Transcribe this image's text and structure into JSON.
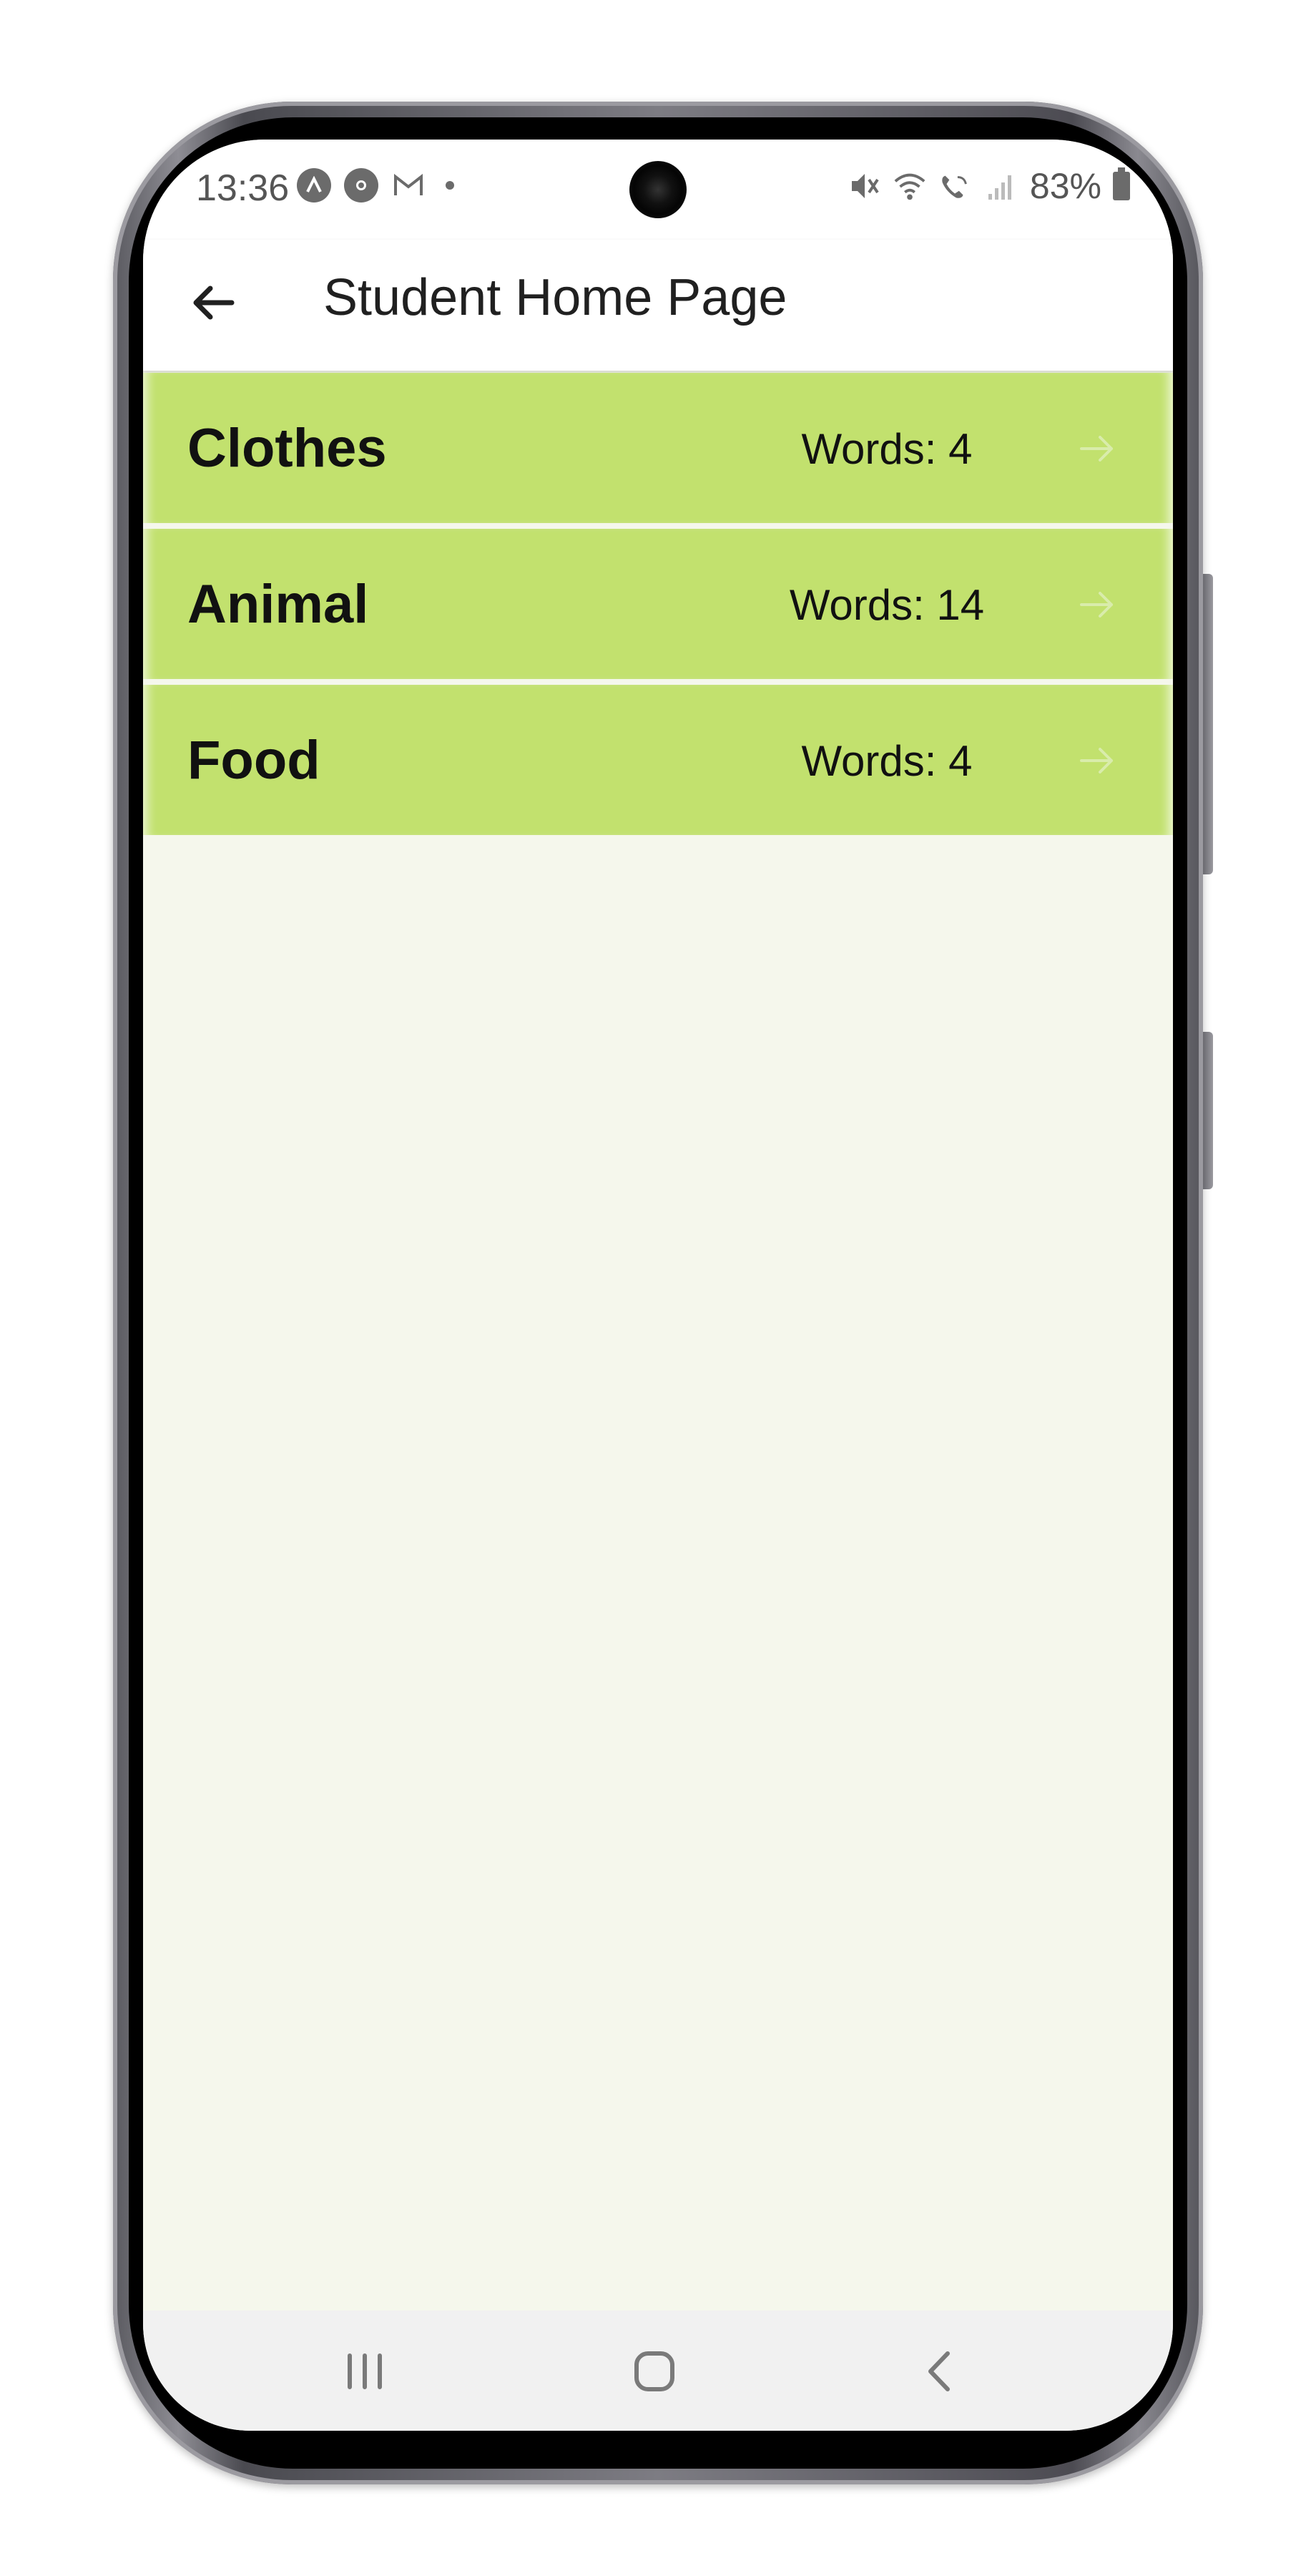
{
  "status_bar": {
    "time": "13:36",
    "battery": "83%",
    "left_icons": [
      "app-a-icon",
      "chrome-icon",
      "gmail-icon",
      "notification-dot-icon"
    ],
    "right_icons": [
      "mute-icon",
      "wifi-icon",
      "wifi-call-icon",
      "signal-icon",
      "battery-icon"
    ]
  },
  "app_bar": {
    "title": "Student Home Page",
    "back_icon": "back-arrow-icon"
  },
  "categories": [
    {
      "name": "Clothes",
      "words": "Words: 4"
    },
    {
      "name": "Animal",
      "words": "Words: 14"
    },
    {
      "name": "Food",
      "words": "Words: 4"
    }
  ],
  "nav_bar": {
    "buttons": [
      "recent-apps-icon",
      "home-icon",
      "back-icon"
    ]
  },
  "colors": {
    "row_background": "#c2e16e",
    "page_background": "#f5f7ec",
    "app_bar": "#ffffff",
    "nav_bar": "#f1f1f1"
  }
}
